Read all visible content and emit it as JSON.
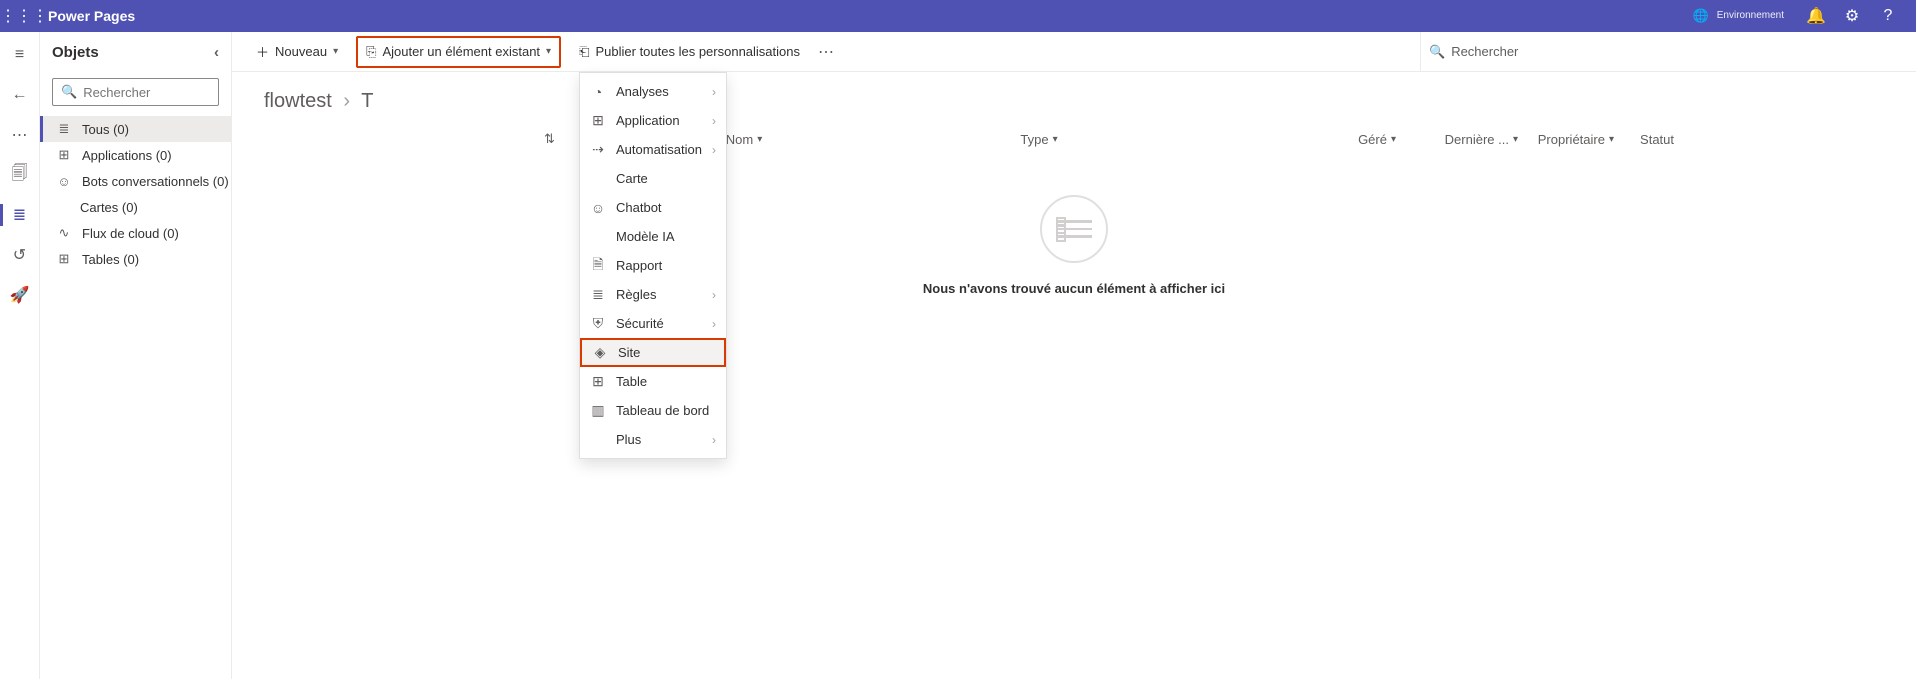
{
  "header": {
    "brand": "Power Pages",
    "env_label": "Environnement",
    "env_value": " "
  },
  "leftpane": {
    "title": "Objets",
    "search_placeholder": "Rechercher",
    "items": [
      {
        "label": "Tous  (0)"
      },
      {
        "label": "Applications  (0)"
      },
      {
        "label": "Bots conversationnels  (0)"
      },
      {
        "label": "Cartes  (0)"
      },
      {
        "label": "Flux de cloud  (0)"
      },
      {
        "label": "Tables  (0)"
      }
    ]
  },
  "cmdbar": {
    "new_label": "Nouveau",
    "add_existing_label": "Ajouter un élément existant",
    "publish_label": "Publier toutes les personnalisations",
    "search_placeholder": "Rechercher"
  },
  "breadcrumb": {
    "solution": "flowtest",
    "page": "T"
  },
  "columns": {
    "name": "Nom",
    "type": "Type",
    "managed": "Géré",
    "last": "Dernière ...",
    "owner": "Propriétaire",
    "status": "Statut"
  },
  "menu": {
    "items": [
      {
        "label": "Analyses",
        "icon": "◔",
        "sub": true
      },
      {
        "label": "Application",
        "icon": "⊞",
        "sub": true
      },
      {
        "label": "Automatisation",
        "icon": "⇢",
        "sub": true
      },
      {
        "label": "Carte",
        "icon": "",
        "indent": true
      },
      {
        "label": "Chatbot",
        "icon": "☺"
      },
      {
        "label": "Modèle IA",
        "icon": "",
        "indent": true
      },
      {
        "label": "Rapport",
        "icon": "🗎"
      },
      {
        "label": "Règles",
        "icon": "≣",
        "sub": true
      },
      {
        "label": "Sécurité",
        "icon": "⛨",
        "sub": true
      },
      {
        "label": "Site",
        "icon": "◈",
        "highlight": true
      },
      {
        "label": "Table",
        "icon": "⊞"
      },
      {
        "label": "Tableau de bord",
        "icon": "▥"
      },
      {
        "label": "Plus",
        "icon": "",
        "sub": true,
        "indent": true
      }
    ]
  },
  "empty_text": "Nous n'avons trouvé aucun élément à afficher ici"
}
